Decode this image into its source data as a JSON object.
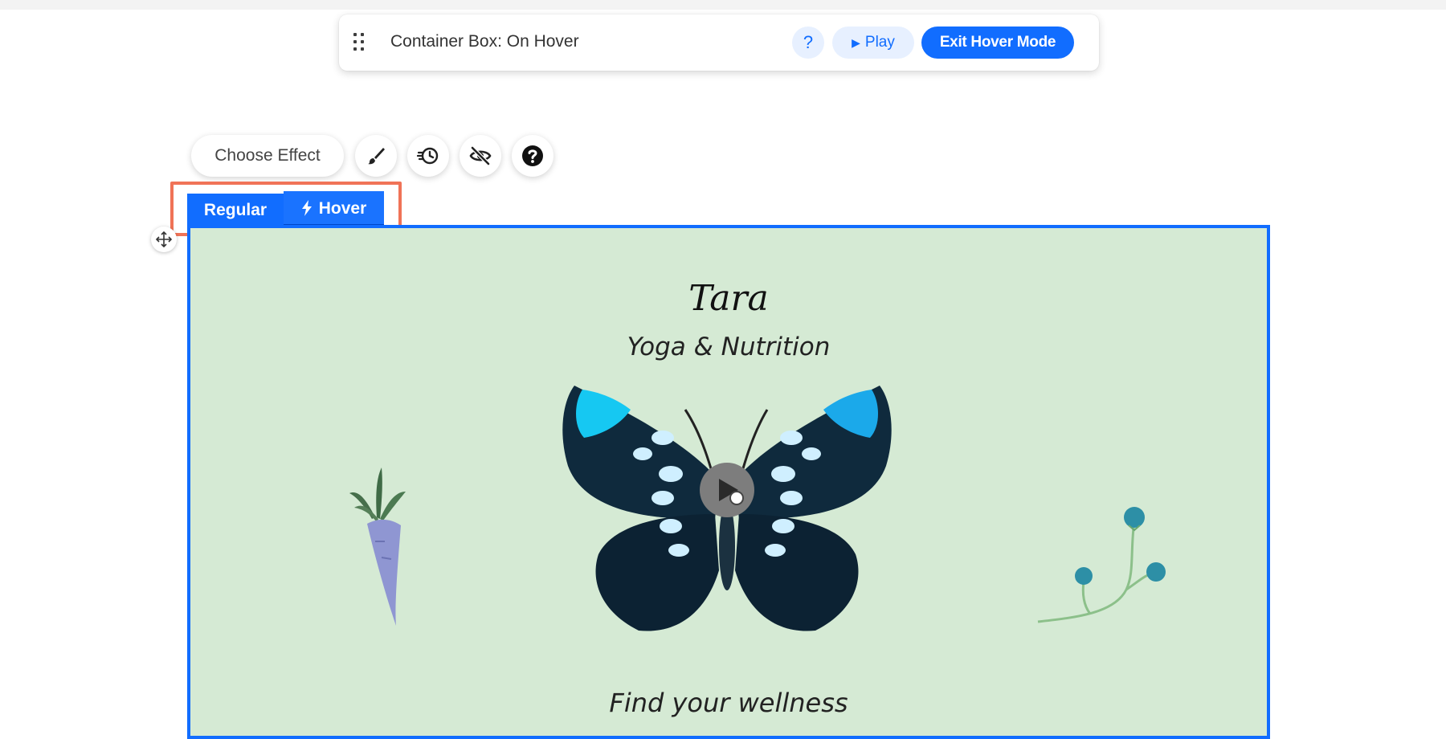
{
  "hover_bar": {
    "title": "Container Box: On Hover",
    "help_label": "?",
    "play_label": "Play",
    "exit_label": "Exit Hover Mode"
  },
  "effect_toolbar": {
    "choose_effect_label": "Choose Effect",
    "icons": [
      "brush-icon",
      "history-icon",
      "hide-icon",
      "help-icon"
    ]
  },
  "state_tabs": {
    "regular_label": "Regular",
    "hover_label": "Hover",
    "selected": "Hover"
  },
  "site": {
    "title": "Tara",
    "subtitle": "Yoga & Nutrition",
    "tagline": "Find your wellness"
  },
  "colors": {
    "accent": "#116dff",
    "highlight": "#f07357",
    "container_bg": "#d5ead4"
  }
}
